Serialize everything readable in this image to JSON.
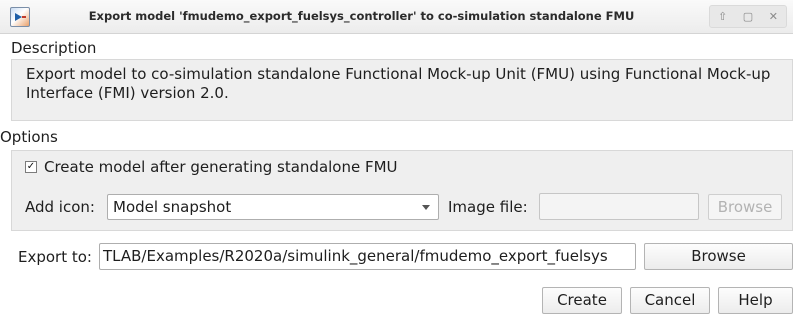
{
  "window": {
    "title": "Export model 'fmudemo_export_fuelsys_controller' to co-simulation standalone FMU",
    "controls": [
      "⇧",
      "▢",
      "✕"
    ]
  },
  "description": {
    "heading": "Description",
    "text": "Export model to co-simulation standalone Functional Mock-up Unit (FMU) using Functional Mock-up Interface (FMI) version 2.0."
  },
  "options": {
    "heading": "Options",
    "create_model_checked": true,
    "create_model_mark": "✓",
    "create_model_label": "Create model after generating standalone FMU",
    "add_icon_label": "Add icon:",
    "add_icon_value": "Model snapshot",
    "image_file_label": "Image file:",
    "image_file_value": "",
    "image_browse_label": "Browse"
  },
  "export": {
    "label": "Export to:",
    "path": "TLAB/Examples/R2020a/simulink_general/fmudemo_export_fuelsys",
    "browse_label": "Browse"
  },
  "footer": {
    "create_label": "Create",
    "cancel_label": "Cancel",
    "help_label": "Help"
  }
}
